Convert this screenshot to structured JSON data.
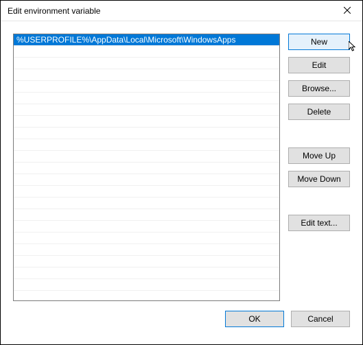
{
  "window": {
    "title": "Edit environment variable"
  },
  "list": {
    "items": [
      "%USERPROFILE%\\AppData\\Local\\Microsoft\\WindowsApps"
    ],
    "selected_index": 0,
    "visible_rows": 22
  },
  "buttons": {
    "new": "New",
    "edit": "Edit",
    "browse": "Browse...",
    "delete": "Delete",
    "move_up": "Move Up",
    "move_down": "Move Down",
    "edit_text": "Edit text...",
    "ok": "OK",
    "cancel": "Cancel"
  }
}
